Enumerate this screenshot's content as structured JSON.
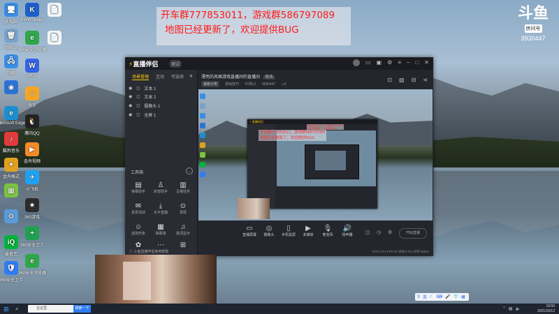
{
  "overlay": {
    "line1": "开车群777853011，游戏群586797089",
    "line2": "地图已经更新了，欢迎提供BUG"
  },
  "room_badge": {
    "logo": "斗鱼",
    "label": "房间号",
    "number": "3930447"
  },
  "desktop_icons": [
    {
      "label": "此电脑",
      "color": "#3a8ee6",
      "glyph": "🖥"
    },
    {
      "label": "回收站",
      "color": "#7aa3c9",
      "glyph": "🗑"
    },
    {
      "label": "网络",
      "color": "#3a8ee6",
      "glyph": "🖧"
    },
    {
      "label": "",
      "color": "#2b73d6",
      "glyph": "◉"
    },
    {
      "label": "Microsoft Edge",
      "color": "#1c8fd1",
      "glyph": "e"
    },
    {
      "label": "酷狗音乐",
      "color": "#e23b3b",
      "glyph": "♪"
    },
    {
      "label": "金舟格式",
      "color": "#e0a020",
      "glyph": "✦"
    },
    {
      "label": "",
      "color": "#7ac343",
      "glyph": "▦"
    },
    {
      "label": "",
      "color": "#5a9bd8",
      "glyph": "⚙"
    },
    {
      "label": "爱奇艺",
      "color": "#00b33c",
      "glyph": "iQ"
    },
    {
      "label": "360安全卫士",
      "color": "#2f7cf6",
      "glyph": "🛡"
    }
  ],
  "desktop_icons2": [
    {
      "label": "KWWSpider",
      "color": "#1f5fc9",
      "glyph": "K"
    },
    {
      "label": "360安全浏览器",
      "color": "#2fa64a",
      "glyph": "e"
    },
    {
      "label": "WPS",
      "color": "#3463e6",
      "glyph": "W"
    },
    {
      "label": "快手",
      "color": "#f5a623",
      "glyph": "☺"
    },
    {
      "label": "腾讯QQ",
      "color": "#222",
      "glyph": "🐧"
    },
    {
      "label": "金舟视频",
      "color": "#f28c28",
      "glyph": "▶"
    },
    {
      "label": "小飞机",
      "color": "#1da1f2",
      "glyph": "✈"
    },
    {
      "label": "360游戏",
      "color": "#2c2c2c",
      "glyph": "★"
    },
    {
      "label": "360安全卫士",
      "color": "#20a050",
      "glyph": "+"
    },
    {
      "label": "360安全浏览器",
      "color": "#2fa64a",
      "glyph": "e"
    }
  ],
  "desktop_icons3": [
    {
      "label": "",
      "color": "#f5f5f5",
      "glyph": "📄"
    },
    {
      "label": "",
      "color": "#f5f5f5",
      "glyph": "📄"
    }
  ],
  "window": {
    "app_name": "直播伴侣",
    "version": "测试",
    "left_tabs": [
      "场景管理",
      "互动",
      "可选项"
    ],
    "scenes": [
      "文本 1",
      "文本 2",
      "摄像头 1",
      "全屏 1"
    ],
    "tools_title": "工具箱",
    "tools": [
      "弹幕助手",
      "房管助手",
      "主播任务",
      "投票活动",
      "水平直播",
      "录屏",
      "虚拟形象",
      "弹幕墙",
      "歌词显示",
      "美颜",
      "更多"
    ],
    "status_left": "斗鱼直播伴侣使用帮助",
    "stage_title": "漂亮的风格游戏直播间的直播间",
    "stage_tag": "修改",
    "stage_sub": [
      "最新分类",
      "游戏技巧",
      "TD阿斗",
      "3930447",
      "0"
    ],
    "bottom_tools": [
      "直播屏幕",
      "摄像头",
      "手机投屏",
      "多媒体",
      "麦克风",
      "扬声器"
    ],
    "start_label": "开始直播",
    "stats": "CPU:12%   FPS:30   丢帧:0.0%   码率:0kbps"
  },
  "nested": {
    "line1": "开车群777853011，游戏群586797089",
    "line2": "地图已经更新了，欢迎提供BUG"
  },
  "taskbar": {
    "search_placeholder": "在这里",
    "search_button": "搜索一下",
    "time": "19:50",
    "date": "2021/10/12"
  }
}
